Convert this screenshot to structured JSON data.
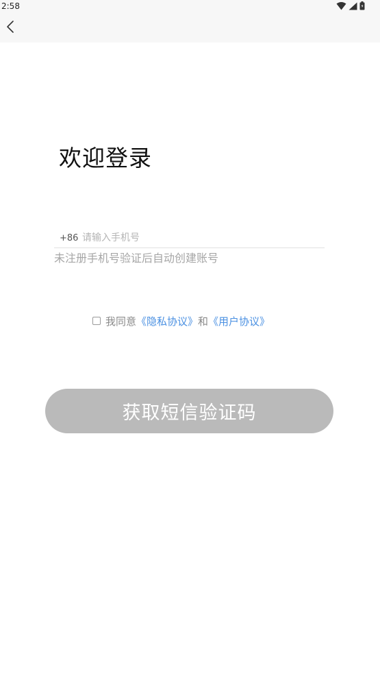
{
  "status_bar": {
    "time": "2:58",
    "icons": [
      "wifi-icon",
      "signal-icon",
      "battery-icon"
    ]
  },
  "header": {
    "back_icon": "chevron-left-icon"
  },
  "login": {
    "title": "欢迎登录",
    "country_code": "+86",
    "phone_placeholder": "请输入手机号",
    "phone_value": "",
    "hint": "未注册手机号验证后自动创建账号",
    "agreement": {
      "checked": false,
      "prefix": "我同意",
      "privacy_link": "《隐私协议》",
      "conjunction": "和",
      "user_link": "《用户协议》"
    },
    "submit_label": "获取短信验证码"
  },
  "colors": {
    "link": "#4a90e2",
    "button_disabled": "#bababa",
    "topbar_bg": "#f7f7f7"
  }
}
